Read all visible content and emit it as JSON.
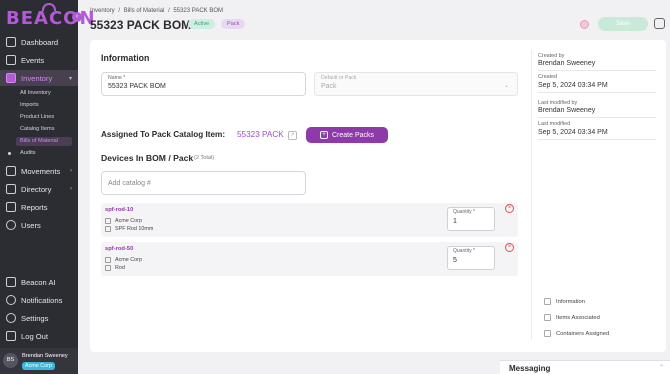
{
  "app": {
    "logo_text": "BEACON"
  },
  "sidebar": {
    "items": [
      {
        "label": "Dashboard",
        "icon": "dashboard-icon"
      },
      {
        "label": "Events",
        "icon": "calendar-icon"
      },
      {
        "label": "Inventory",
        "icon": "inventory-icon"
      },
      {
        "label": "Movements",
        "icon": "movements-icon"
      },
      {
        "label": "Directory",
        "icon": "directory-icon"
      },
      {
        "label": "Reports",
        "icon": "reports-icon"
      },
      {
        "label": "Users",
        "icon": "users-icon"
      },
      {
        "label": "Beacon AI",
        "icon": "sparkle-icon"
      },
      {
        "label": "Notifications",
        "icon": "bell-icon"
      },
      {
        "label": "Settings",
        "icon": "gear-icon"
      },
      {
        "label": "Log Out",
        "icon": "logout-icon"
      }
    ],
    "inventory_sub": [
      {
        "label": "All Inventory"
      },
      {
        "label": "Imports"
      },
      {
        "label": "Product Lines"
      },
      {
        "label": "Catalog Items"
      },
      {
        "label": "Bills of Material"
      },
      {
        "label": "Audits"
      }
    ],
    "user": {
      "initials": "BS",
      "name": "Brendan Sweeney",
      "company": "Acme Corp"
    }
  },
  "header": {
    "breadcrumb": [
      "Inventory",
      "/",
      "Bills of Material",
      "/",
      "55323 PACK BOM"
    ],
    "title": "55323 PACK BOM",
    "badge_active": "Active",
    "badge_pack": "Pack",
    "save_label": "Save"
  },
  "information": {
    "title": "Information",
    "name_label": "Name *",
    "name_value": "55323 PACK BOM",
    "default_label": "Default or Pack",
    "default_value": "Pack"
  },
  "assigned": {
    "label": "Assigned To Pack Catalog Item:",
    "item": "55323 PACK",
    "create_label": "Create Packs"
  },
  "devices": {
    "title": "Devices In BOM / Pack",
    "count": "(2 Total)",
    "catalog_placeholder": "Add catalog #",
    "rows": [
      {
        "name": "spf-rod-10",
        "company": "Acme Corp",
        "description": "SPF Rod 10mm",
        "qty_label": "Quantity *",
        "qty": "1"
      },
      {
        "name": "spf-rod-50",
        "company": "Acme Corp",
        "description": "Rod",
        "qty_label": "Quantity *",
        "qty": "5"
      }
    ]
  },
  "meta": {
    "created_by_label": "Created by",
    "created_by": "Brendan Sweeney",
    "created_label": "Created",
    "created": "Sep 5, 2024 03:34 PM",
    "modified_by_label": "Last modified by",
    "modified_by": "Brendan Sweeney",
    "modified_label": "Last modified",
    "modified": "Sep 5, 2024 03:34 PM"
  },
  "toc": [
    {
      "label": "Information"
    },
    {
      "label": "Items Associated"
    },
    {
      "label": "Containers Assigned"
    }
  ],
  "messaging": {
    "label": "Messaging"
  },
  "colors": {
    "accent": "#8e3aa8",
    "sidebar_bg": "#2c2c33",
    "active_badge": "#cdeee1",
    "pack_badge": "#e8d9f2"
  }
}
